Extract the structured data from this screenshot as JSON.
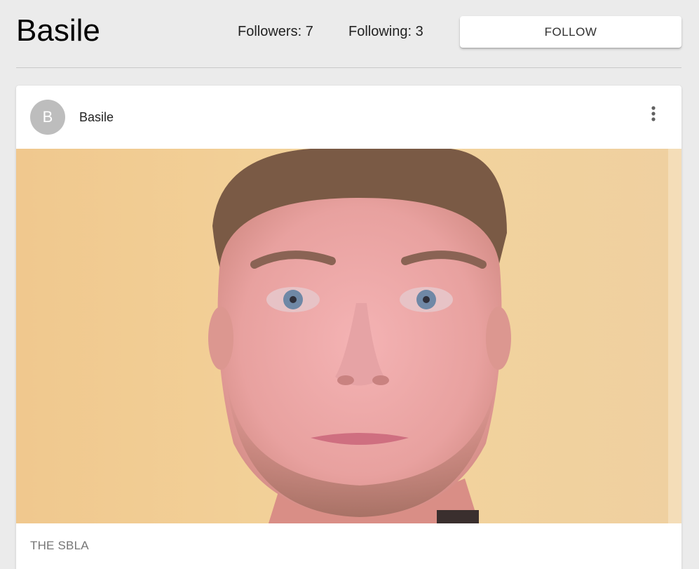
{
  "profile": {
    "name": "Basile",
    "followers_label": "Followers: 7",
    "following_label": "Following: 3",
    "follow_button_label": "FOLLOW"
  },
  "post": {
    "avatar_letter": "B",
    "author": "Basile",
    "menu_icon": "more-vert-icon",
    "image_icon": "portrait-photo",
    "caption": "THE SBLA"
  },
  "colors": {
    "background": "#ebebeb",
    "card": "#ffffff",
    "avatar": "#bdbdbd",
    "caption": "#757575"
  }
}
